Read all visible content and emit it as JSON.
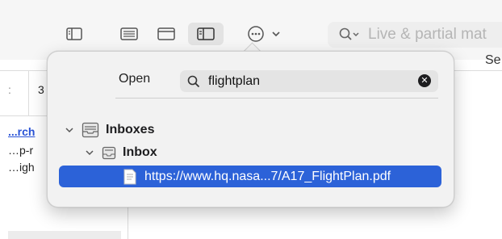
{
  "toolbar": {
    "search_placeholder": "Live & partial mat",
    "column_header_right": "Se"
  },
  "background": {
    "cell_left": ":",
    "cell_number": "3",
    "link_text": "...rch",
    "row1": "…p-r",
    "row2": "…igh"
  },
  "popover": {
    "open_label": "Open",
    "search_value": "flightplan",
    "tree": [
      {
        "label": "Inboxes",
        "expanded": true
      },
      {
        "label": "Inbox",
        "expanded": true
      }
    ],
    "selected_item": "https://www.hq.nasa...7/A17_FlightPlan.pdf"
  },
  "colors": {
    "selection": "#2c62d8",
    "link": "#2a53d6"
  }
}
